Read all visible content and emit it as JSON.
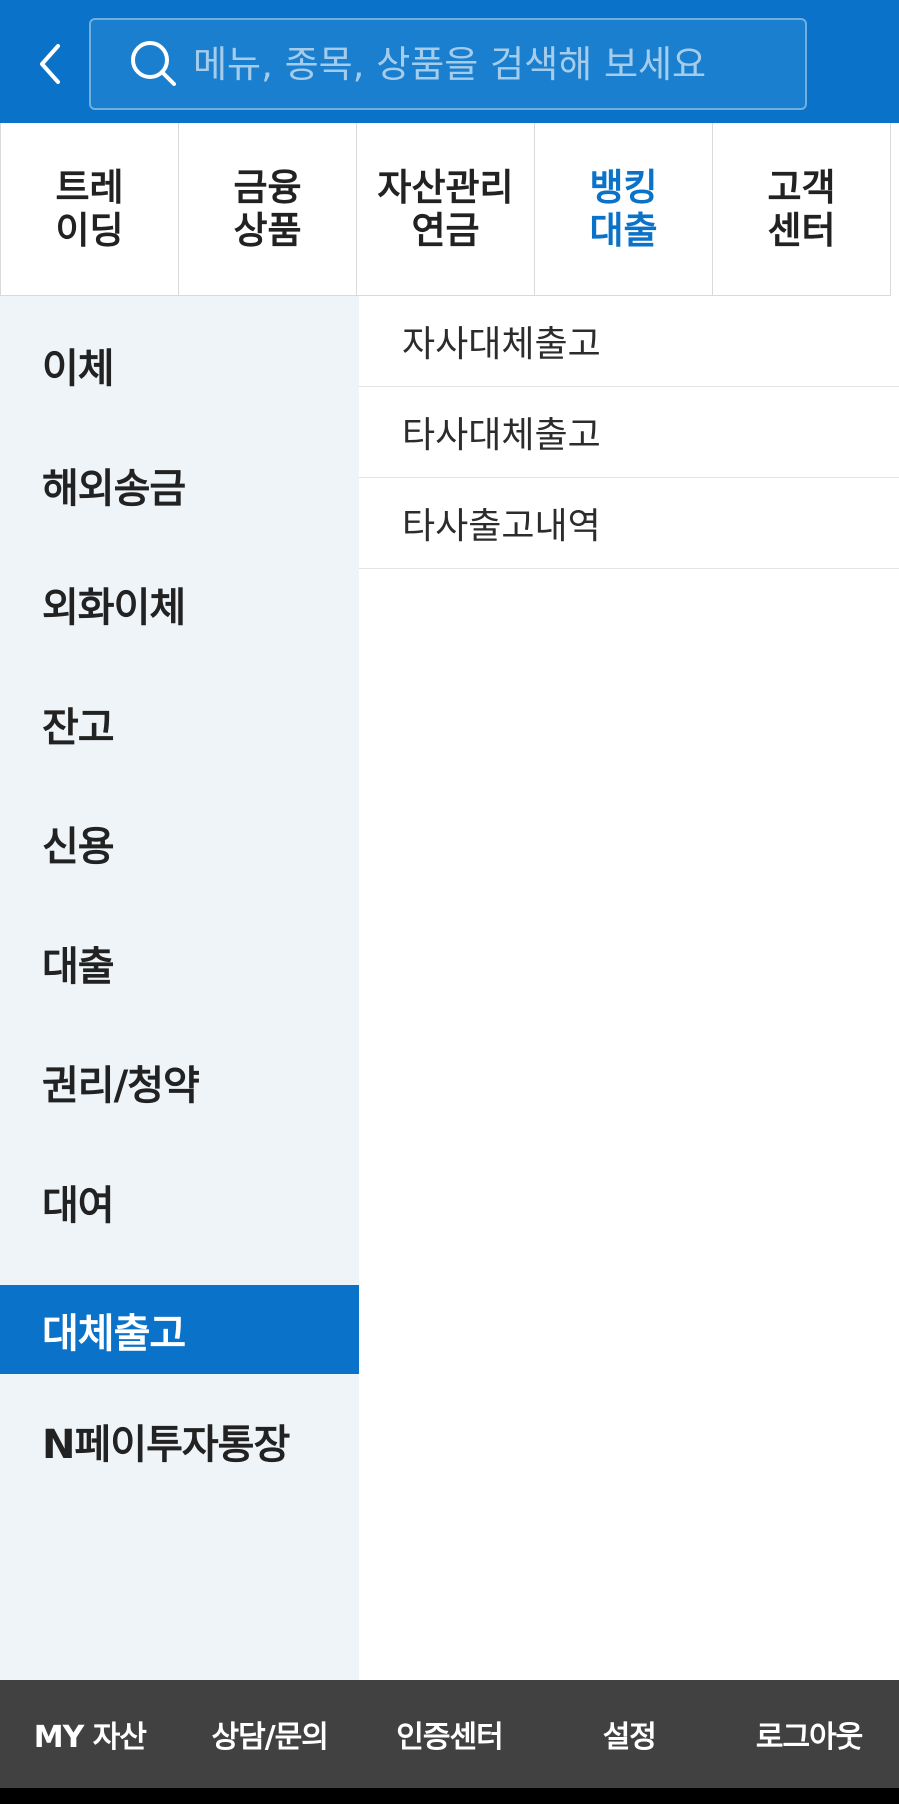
{
  "search": {
    "placeholder": "메뉴, 종목, 상품을 검색해 보세요"
  },
  "tabs": [
    {
      "label": "트레\n이딩",
      "active": false
    },
    {
      "label": "금융\n상품",
      "active": false
    },
    {
      "label": "자산관리\n연금",
      "active": false
    },
    {
      "label": "뱅킹\n대출",
      "active": true
    },
    {
      "label": "고객\n센터",
      "active": false
    }
  ],
  "categories": [
    {
      "label": "이체"
    },
    {
      "label": "해외송금"
    },
    {
      "label": "외화이체"
    },
    {
      "label": "잔고"
    },
    {
      "label": "신용"
    },
    {
      "label": "대출"
    },
    {
      "label": "권리/청약"
    },
    {
      "label": "대여"
    },
    {
      "label": "대체출고",
      "active": true
    },
    {
      "label": "N페이투자통장"
    }
  ],
  "submenu": [
    {
      "label": "자사대체출고"
    },
    {
      "label": "타사대체출고"
    },
    {
      "label": "타사출고내역"
    }
  ],
  "bottom": [
    {
      "label": "MY 자산"
    },
    {
      "label": "상담/문의"
    },
    {
      "label": "인증센터"
    },
    {
      "label": "설정"
    },
    {
      "label": "로그아웃"
    }
  ],
  "colors": {
    "primary": "#0a72c8",
    "nav_bg": "#eef4f8",
    "bottom_bg": "#414141"
  }
}
